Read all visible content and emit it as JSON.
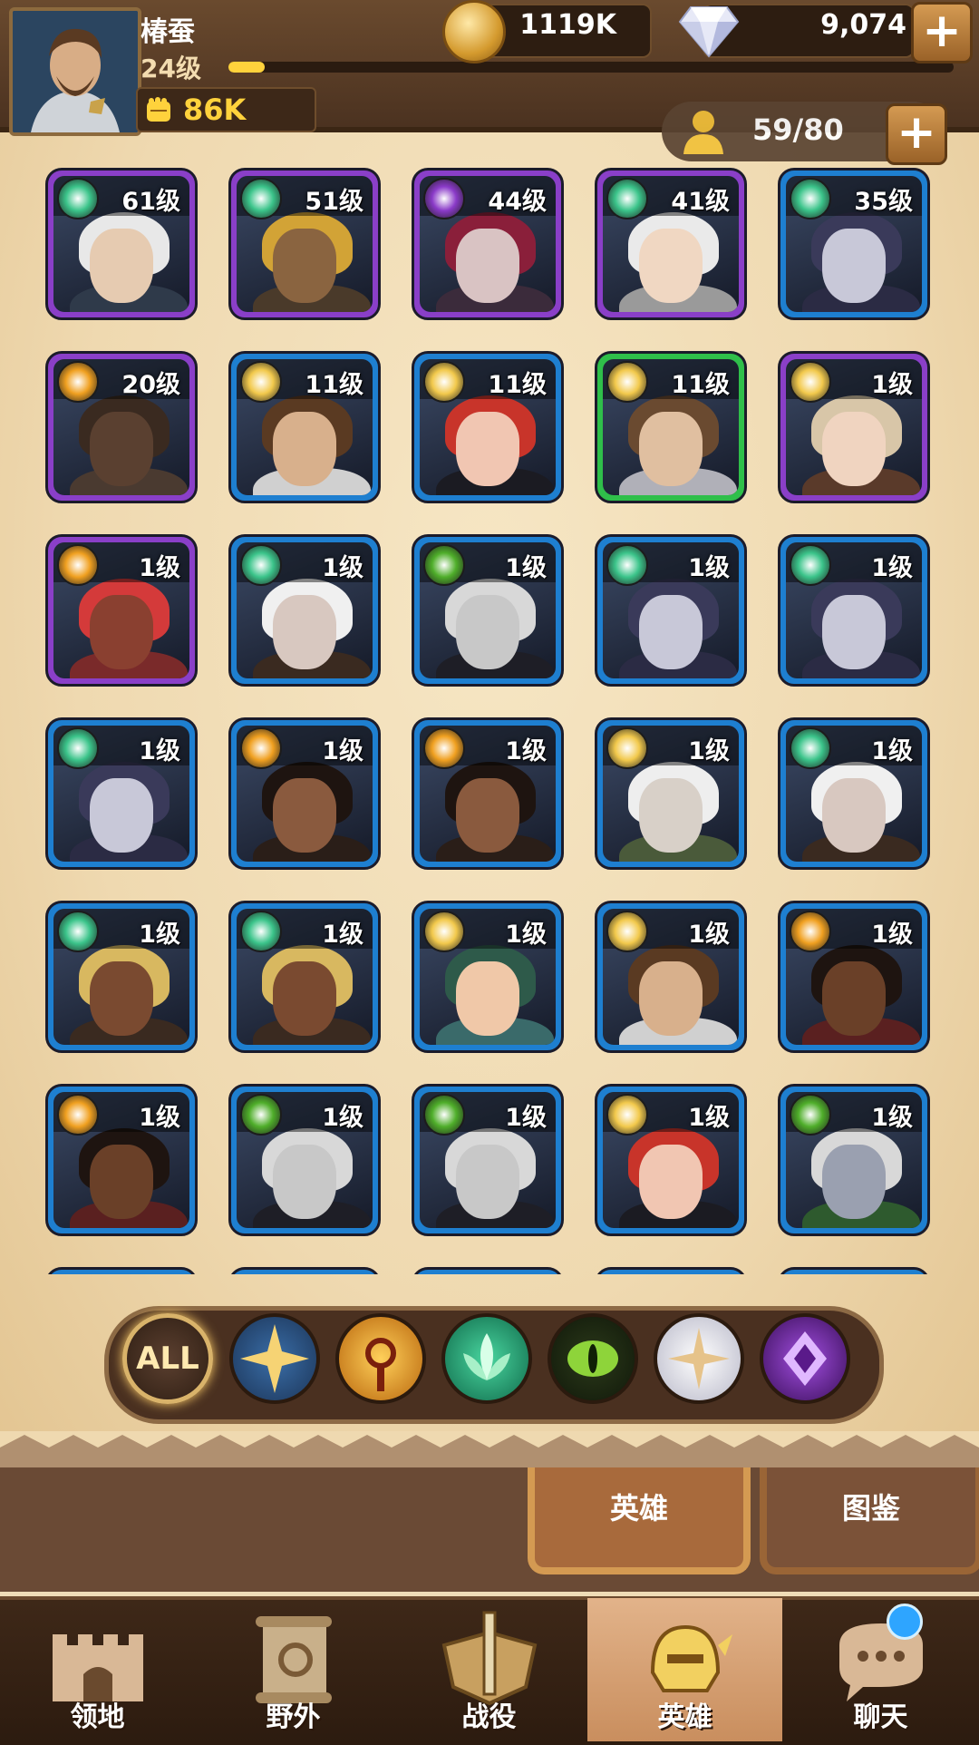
{
  "player": {
    "name": "椿蚕",
    "level": "24级",
    "xp_progress": 0.05,
    "power": "86K"
  },
  "resources": {
    "gold": "1119K",
    "gems": "9,074"
  },
  "hero_count": "59/80",
  "heroes": [
    {
      "level": "61级",
      "faction": "forest",
      "frame": "purple",
      "skin": "#e6cbb1",
      "hair": "#e8e8e8",
      "body": "#2f3a4a"
    },
    {
      "level": "51级",
      "faction": "forest",
      "frame": "purple",
      "skin": "#8a6440",
      "hair": "#d2a336",
      "body": "#4a3a2a"
    },
    {
      "level": "44级",
      "faction": "void",
      "frame": "purple",
      "skin": "#d9c3c3",
      "hair": "#8a1f3a",
      "body": "#3b2b3b"
    },
    {
      "level": "41级",
      "faction": "forest",
      "frame": "purple",
      "skin": "#f0d7c2",
      "hair": "#eaeaea",
      "body": "#9a9a9a"
    },
    {
      "level": "35级",
      "faction": "forest",
      "frame": "blue",
      "skin": "#c8c8d8",
      "hair": "#3a3a5a",
      "body": "#2b2b44"
    },
    {
      "level": "20级",
      "faction": "dawn",
      "frame": "purple",
      "skin": "#5a4030",
      "hair": "#3a2a20",
      "body": "#4a3a30"
    },
    {
      "level": "11级",
      "faction": "light",
      "frame": "blue",
      "skin": "#d8b08c",
      "hair": "#5a3a22",
      "body": "#d0d0d0"
    },
    {
      "level": "11级",
      "faction": "light",
      "frame": "blue",
      "skin": "#f1c6b2",
      "hair": "#c8342a",
      "body": "#1b1b22"
    },
    {
      "level": "11级",
      "faction": "light",
      "frame": "green",
      "skin": "#e0bfa0",
      "hair": "#6a4a30",
      "body": "#b0b0b8"
    },
    {
      "level": "1级",
      "faction": "light",
      "frame": "purple",
      "skin": "#f0d4c0",
      "hair": "#d8c6a8",
      "body": "#5a3a2a"
    },
    {
      "level": "1级",
      "faction": "dawn",
      "frame": "purple",
      "skin": "#8a4030",
      "hair": "#d43a3a",
      "body": "#7a2a2a"
    },
    {
      "level": "1级",
      "faction": "forest",
      "frame": "blue",
      "skin": "#d8c8c0",
      "hair": "#f0f0f0",
      "body": "#3a2a20"
    },
    {
      "level": "1级",
      "faction": "wilder",
      "frame": "blue",
      "skin": "#c8c8c8",
      "hair": "#d8d8d8",
      "body": "#1e1e26"
    },
    {
      "level": "1级",
      "faction": "forest",
      "frame": "blue",
      "skin": "#c8c8d8",
      "hair": "#3a3a5a",
      "body": "#2b2b44"
    },
    {
      "level": "1级",
      "faction": "forest",
      "frame": "blue",
      "skin": "#c8c8d8",
      "hair": "#3a3a5a",
      "body": "#2b2b44"
    },
    {
      "level": "1级",
      "faction": "forest",
      "frame": "blue",
      "skin": "#c8c8d8",
      "hair": "#3a3a5a",
      "body": "#2b2b44"
    },
    {
      "level": "1级",
      "faction": "dawn",
      "frame": "blue",
      "skin": "#8a5a3e",
      "hair": "#1e1410",
      "body": "#2a1e18"
    },
    {
      "level": "1级",
      "faction": "dawn",
      "frame": "blue",
      "skin": "#8a5a3e",
      "hair": "#1e1410",
      "body": "#2a1e18"
    },
    {
      "level": "1级",
      "faction": "light",
      "frame": "blue",
      "skin": "#d8d0c8",
      "hair": "#eeeeee",
      "body": "#4a5a3a"
    },
    {
      "level": "1级",
      "faction": "forest",
      "frame": "blue",
      "skin": "#d8c8c0",
      "hair": "#f0f0f0",
      "body": "#3a2a20"
    },
    {
      "level": "1级",
      "faction": "forest",
      "frame": "blue",
      "skin": "#7a4a30",
      "hair": "#d8b860",
      "body": "#3a2a20"
    },
    {
      "level": "1级",
      "faction": "forest",
      "frame": "blue",
      "skin": "#7a4a30",
      "hair": "#d8b860",
      "body": "#3a2a20"
    },
    {
      "level": "1级",
      "faction": "light",
      "frame": "blue",
      "skin": "#f0c8a8",
      "hair": "#2e5a4a",
      "body": "#3a6a6a"
    },
    {
      "level": "1级",
      "faction": "light",
      "frame": "blue",
      "skin": "#d8b08c",
      "hair": "#5a3a22",
      "body": "#d0d0d0"
    },
    {
      "level": "1级",
      "faction": "dawn",
      "frame": "blue",
      "skin": "#6a4028",
      "hair": "#1e1410",
      "body": "#5a2020"
    },
    {
      "level": "1级",
      "faction": "dawn",
      "frame": "blue",
      "skin": "#6a4028",
      "hair": "#1e1410",
      "body": "#5a2020"
    },
    {
      "level": "1级",
      "faction": "wilder",
      "frame": "blue",
      "skin": "#c8c8c8",
      "hair": "#d8d8d8",
      "body": "#1e1e26"
    },
    {
      "level": "1级",
      "faction": "wilder",
      "frame": "blue",
      "skin": "#c8c8c8",
      "hair": "#d8d8d8",
      "body": "#1e1e26"
    },
    {
      "level": "1级",
      "faction": "light",
      "frame": "blue",
      "skin": "#f1c6b2",
      "hair": "#c8342a",
      "body": "#1b1b22"
    },
    {
      "level": "1级",
      "faction": "wilder",
      "frame": "blue",
      "skin": "#9aa0b0",
      "hair": "#d8d8d8",
      "body": "#2e5a2e"
    }
  ],
  "faction_colors": {
    "light": "#f2c94c",
    "dawn": "#f0a020",
    "forest": "#3bc48a",
    "wilder": "#4fae2a",
    "celestial": "#f3f3f3",
    "void": "#8a3ac8"
  },
  "frame_colors": {
    "purple": "#8a3fc8",
    "blue": "#1e7fd0",
    "green": "#2fbf4a"
  },
  "filters": {
    "all_label": "ALL",
    "factions": [
      "light-faction-icon",
      "dawn-faction-icon",
      "forest-faction-icon",
      "wilder-faction-icon",
      "celestial-faction-icon",
      "void-faction-icon"
    ]
  },
  "sub_tabs": {
    "heroes": "英雄",
    "codex": "图鉴"
  },
  "nav": {
    "territory": "领地",
    "wilds": "野外",
    "campaign": "战役",
    "heroes": "英雄",
    "chat": "聊天"
  }
}
